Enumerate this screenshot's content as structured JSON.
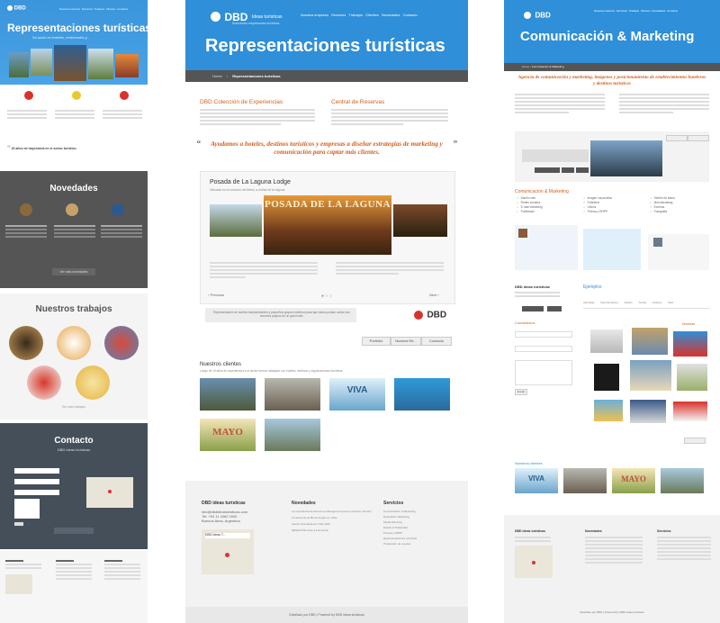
{
  "left": {
    "brand": "DBD",
    "brand_sub": "Ideas turísticas",
    "nav": [
      "Nuestra empresa",
      "Servicios",
      "Trabajos",
      "Clientes",
      "Novedades",
      "Contacto"
    ],
    "hero_title": "Representaciones turísticas",
    "hero_subtitle": "Su socio en hoteles, rent/resorts y...",
    "quote": "15 años de trayectoria en el sector turístico",
    "novedades_title": "Novedades",
    "ver_mas_novedades": "Ver más novedades",
    "trabajos_title": "Nuestros trabajos",
    "ver_mas_trabajos": "Ver más trabajos",
    "contacto_title": "Contacto",
    "contacto_sub": "DBD ideas turísticas"
  },
  "center": {
    "brand": "DBD",
    "brand_name": "Ideas turísticas",
    "brand_tagline": "Soluciones empresarias turísticas",
    "nav": [
      "Nuestra empresa",
      "Servicios",
      "Trabajos",
      "Clientes",
      "Novedades",
      "Contacto"
    ],
    "hero_title": "Representaciones turísticas",
    "breadcrumb": [
      "Home",
      "Representaciones turísticas"
    ],
    "col1_title": "DBD Colección de Experiencias",
    "col2_title": "Central de Reservas",
    "quote": "Ayudamos a hoteles, destinos turísticos y empresas a diseñar estrategias de marketing y comunicación para captar más clientes.",
    "posada_title": "Posada de La Laguna Lodge",
    "posada_sub": "Ubicada en el corazón del Iberá, a orillas de la laguna",
    "posada_banner": "POSADA DE LA LAGUNA",
    "prev_label": "Previous",
    "next_label": "Next",
    "dbd_banner_text": "Representación de hoteles independientes y pequeños grupos hoteleros para que estos puedan contar con recursos propios de un gran hotel.",
    "buttons": [
      "Portfolio",
      "Nuestra Re...",
      "Contacto"
    ],
    "clientes_title": "Nuestros clientes",
    "clientes_sub": "Luego de 15 años de experiencia en el sector hemos trabajado con hoteles, destinos y organizaciones turísticas.",
    "mayo_label": "MAYO",
    "viva_label": "VIVA",
    "footer_col1_title": "DBD ideas turísticas",
    "footer_col1_lines": [
      "info@dbdideasturisticas.com",
      "Tel: +54 11 4362 0000",
      "Buenos Aires, Argentina"
    ],
    "map_label": "DBD Ideas T...",
    "footer_col2_title": "Novedades",
    "footer_col2_items": [
      "La importancia del Revenue Management para un destino turístico",
      "Conferencia de Bruno Engler en Chile",
      "Sesión Enseñada de Chile 2016",
      "SENASTUR Area & Formación"
    ],
    "footer_col3_title": "Servicios",
    "footer_col3_items": [
      "Comunicación & Marketing",
      "Destination Marketing",
      "Media Planning",
      "Diseño & Publicidad",
      "Prensa y RRPP",
      "Representaciones turísticas",
      "Producción de eventos"
    ],
    "copyright": "Diseñado por DBD | Powered by DBD ideas turísticas"
  },
  "right": {
    "brand": "DBD",
    "nav": [
      "Nuestra empresa",
      "Servicios",
      "Trabajos",
      "Clientes",
      "Novedades",
      "Contacto"
    ],
    "hero_title": "Comunicación & Marketing",
    "breadcrumb": [
      "Home",
      "Comunicación & Marketing"
    ],
    "quote": "Agencia de comunicación y marketing, imágenes y posicionamiento de establecimientos hoteleros y destinos turísticos",
    "section_title": "Comunicación & Marketing",
    "checks": [
      "Diseño web",
      "Redes sociales",
      "E-mail marketing",
      "Publicidad",
      "Imagen corporativa",
      "Folletería",
      "Videos",
      "Prensa y RRPP",
      "Diseño de stand",
      "Merchandising",
      "Eventos",
      "Fotografía"
    ],
    "contact_title": "DBD ideas turísticas",
    "ejemplos_title": "Ejemplos",
    "tabs": [
      "Identidad",
      "Merchandising",
      "Diseño",
      "Social",
      "Folletos",
      "Web"
    ],
    "contact_form_title": "Contáctenos",
    "send_label": "Enviar",
    "novedad_label": "Novedad",
    "clientes_title": "Nuestros clientes",
    "viva_label": "VIVA",
    "mayo_label": "MAYO",
    "footer_col1_title": "DBD ideas turísticas",
    "footer_col2_title": "Novedades",
    "footer_col3_title": "Servicios",
    "copyright": "Diseñado por DBD | Powered by DBD ideas turísticas"
  }
}
